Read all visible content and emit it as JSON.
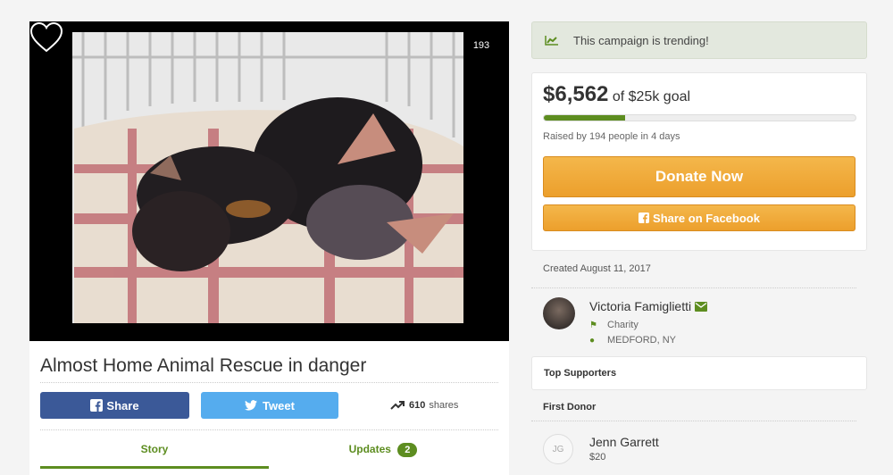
{
  "photo": {
    "likes": "193"
  },
  "campaign": {
    "title": "Almost Home Animal Rescue in danger"
  },
  "share": {
    "facebook_label": "Share",
    "twitter_label": "Tweet",
    "shares_count": "610",
    "shares_label": "shares"
  },
  "tabs": [
    {
      "label": "Story",
      "active": true
    },
    {
      "label": "Updates",
      "badge": "2",
      "active": false
    }
  ],
  "trending": {
    "text": "This campaign is trending!"
  },
  "funding": {
    "raised": "$6,562",
    "goal_text": "of $25k goal",
    "progress": 0.26,
    "raised_by": "Raised by 194 people in 4 days",
    "donate_label": "Donate Now",
    "share_fb_label": "Share on Facebook"
  },
  "organizer": {
    "created": "Created August 11, 2017",
    "name": "Victoria Famiglietti",
    "category": "Charity",
    "location": "MEDFORD, NY"
  },
  "supporters": {
    "top_label": "Top Supporters",
    "first_donor_label": "First Donor",
    "donor_initials": "JG",
    "donor_name": "Jenn Garrett",
    "donor_amount": "$20"
  },
  "colors": {
    "accent_green": "#5d8d20",
    "donate_orange": "#ec9f2c",
    "facebook_blue": "#3b5998",
    "twitter_blue": "#55acee"
  }
}
